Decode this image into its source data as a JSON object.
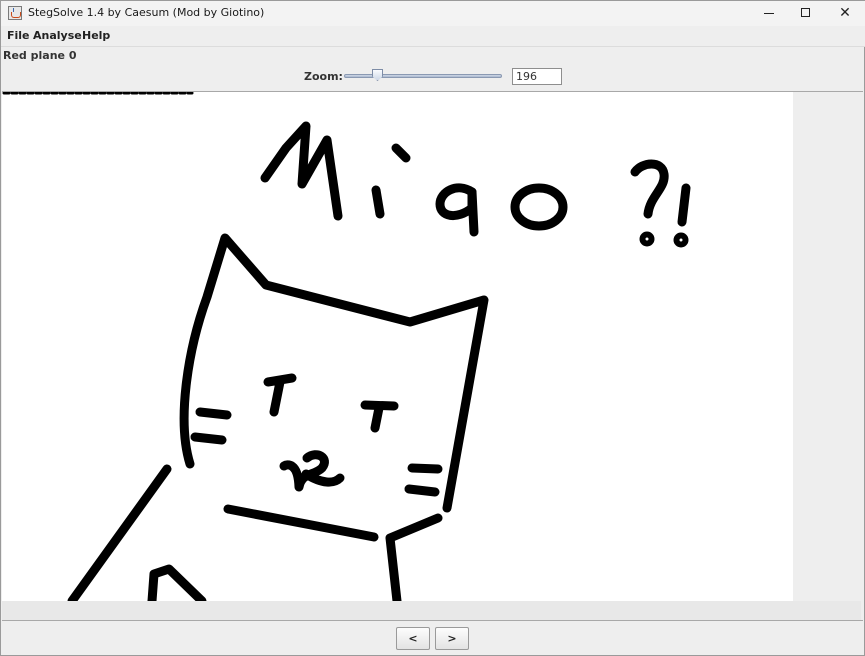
{
  "window": {
    "title": "StegSolve 1.4 by Caesum (Mod by Giotino)",
    "controls": {
      "minimize": "─",
      "maximize": "☐",
      "close": "✕"
    }
  },
  "menu": [
    "File",
    "Analyse",
    "Help"
  ],
  "plane_label": "Red plane 0",
  "zoom": {
    "label": "Zoom:",
    "value": "196",
    "slider_fraction": 0.19
  },
  "image": {
    "description_icon": "cat-drawing",
    "handwritten_text": "Miao ?!"
  },
  "nav": {
    "prev_label": "<",
    "next_label": ">"
  }
}
